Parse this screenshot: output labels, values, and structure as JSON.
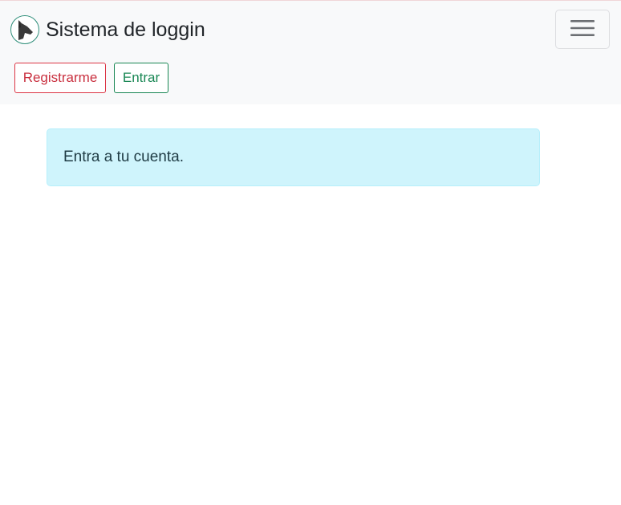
{
  "navbar": {
    "brand_title": "Sistema de loggin",
    "logo_icon": "dog-head-icon",
    "toggler_icon": "hamburger-menu-icon",
    "buttons": {
      "register_label": "Registrarme",
      "login_label": "Entrar"
    }
  },
  "main": {
    "alert_text": "Entra a tu cuenta."
  },
  "colors": {
    "navbar_bg": "#f8f9fa",
    "register_accent": "#dc3545",
    "login_accent": "#198754",
    "alert_bg": "#cff4fc"
  }
}
